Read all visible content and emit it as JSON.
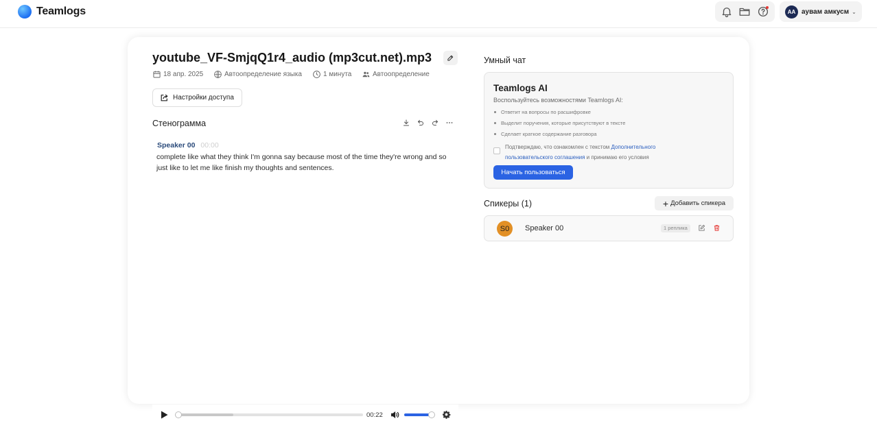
{
  "app": {
    "name": "Teamlogs"
  },
  "header": {
    "user": {
      "initials": "AA",
      "name": "аувам амкусм"
    }
  },
  "file": {
    "title": "youtube_VF-SmjqQ1r4_audio (mp3cut.net).mp3",
    "date": "18 апр. 2025",
    "language": "Автоопределение языка",
    "duration": "1 минута",
    "speakers_mode": "Автоопределение",
    "access_label": "Настройки доступа"
  },
  "transcript": {
    "title": "Стенограмма",
    "segments": [
      {
        "speaker": "Speaker 00",
        "time": "00:00",
        "text": "complete like what they think I'm gonna say because most of the time they're wrong and so just like to let me like finish my thoughts and sentences."
      }
    ]
  },
  "smart_chat": {
    "title": "Умный чат",
    "ai_title": "Teamlogs AI",
    "ai_subtitle": "Воспользуйтесь возможностями Teamlogs AI:",
    "features": [
      "Ответит на вопросы по расшифровке",
      "Выделит поручения, которые присутствуют в тексте",
      "Сделает краткое содержание разговора"
    ],
    "agree_prefix": "Подтверждаю, что ознакомлен с текстом ",
    "agree_link": "Дополнительного пользовательского соглашения",
    "agree_suffix": " и принимаю его условия",
    "start_label": "Начать пользоваться"
  },
  "speakers": {
    "title": "Спикеры (1)",
    "add_label": "Добавить спикера",
    "items": [
      {
        "initials": "S0",
        "name": "Speaker 00",
        "replicas": "1 реплика",
        "color": "#e29026"
      }
    ]
  },
  "player": {
    "time": "00:22",
    "progress": 0.0,
    "buffered": 0.31,
    "volume": 0.88
  }
}
